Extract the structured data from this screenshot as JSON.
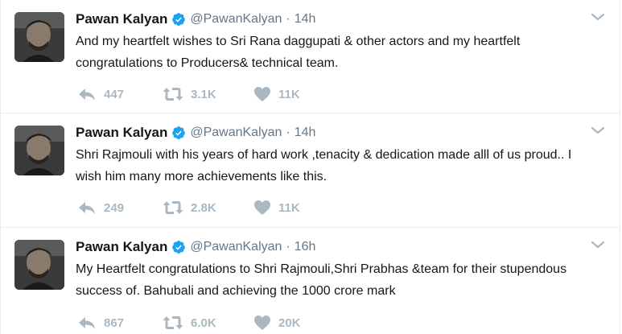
{
  "tweets": [
    {
      "name": "Pawan Kalyan",
      "handle": "@PawanKalyan",
      "separator": "·",
      "time": "14h",
      "text": "And my heartfelt wishes to Sri Rana daggupati & other actors and my heartfelt congratulations to Producers& technical team.",
      "replies": "447",
      "retweets": "3.1K",
      "likes": "11K"
    },
    {
      "name": "Pawan Kalyan",
      "handle": "@PawanKalyan",
      "separator": "·",
      "time": "14h",
      "text": "Shri Rajmouli with his years of hard work ,tenacity & dedication made alll of us proud.. I wish him many more achievements like this.",
      "replies": "249",
      "retweets": "2.8K",
      "likes": "11K"
    },
    {
      "name": "Pawan Kalyan",
      "handle": "@PawanKalyan",
      "separator": "·",
      "time": "16h",
      "text": "My Heartfelt congratulations to Shri Rajmouli,Shri Prabhas &team for their stupendous success of. Bahubali and achieving the 1000 crore mark",
      "replies": "867",
      "retweets": "6.0K",
      "likes": "20K"
    }
  ],
  "icons": {
    "verified": "verified-badge-icon",
    "caret": "chevron-down-icon",
    "reply": "reply-icon",
    "retweet": "retweet-icon",
    "like": "heart-icon"
  },
  "colors": {
    "verified_badge": "#1da1f2",
    "muted_text": "#657786",
    "action_icon": "#aab8c2",
    "divider": "#e6ecf0"
  }
}
